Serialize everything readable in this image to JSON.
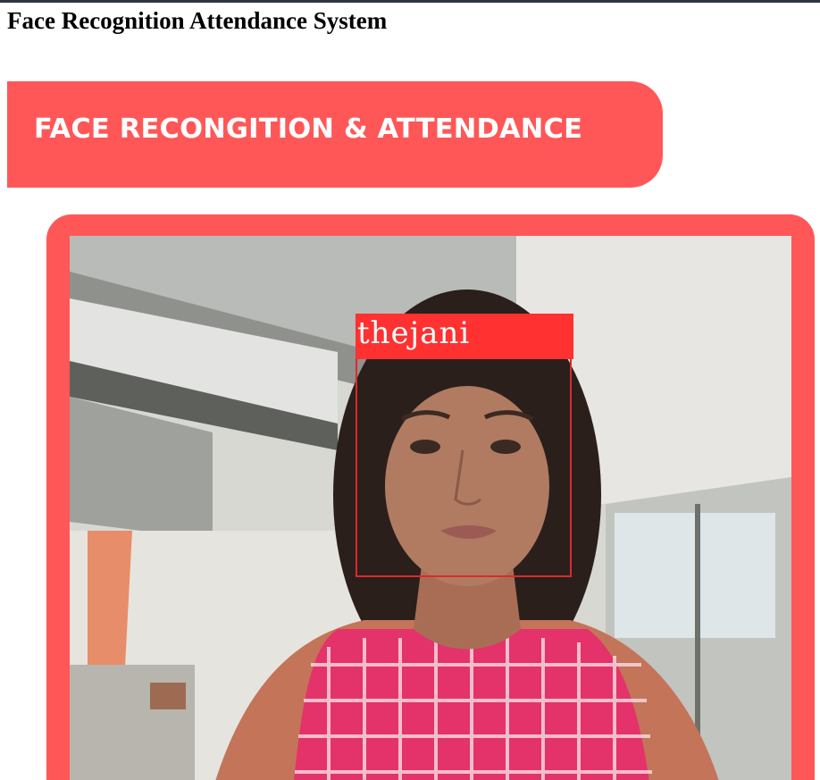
{
  "page": {
    "title": "Face Recognition Attendance System"
  },
  "banner": {
    "text": "FACE RECONGITION & ATTENDANCE",
    "color": "#ff5757"
  },
  "camera": {
    "frame_color": "#ff5757",
    "detection": {
      "name": "thejani",
      "box_color": "#d92b2b",
      "label_bg": "#ff3131"
    }
  }
}
